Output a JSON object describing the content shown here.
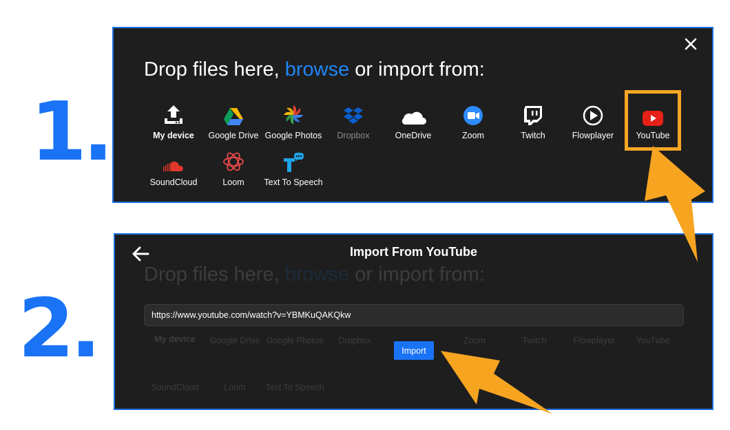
{
  "steps": [
    "1.",
    "2."
  ],
  "panel1": {
    "heading_pre": "Drop files here,",
    "heading_link": "browse",
    "heading_post": "or import from:",
    "sources": [
      {
        "label": "My device",
        "icon": "upload-icon"
      },
      {
        "label": "Google Drive",
        "icon": "google-drive-icon"
      },
      {
        "label": "Google Photos",
        "icon": "google-photos-icon"
      },
      {
        "label": "Dropbox",
        "icon": "dropbox-icon"
      },
      {
        "label": "OneDrive",
        "icon": "onedrive-icon"
      },
      {
        "label": "Zoom",
        "icon": "zoom-icon"
      },
      {
        "label": "Twitch",
        "icon": "twitch-icon"
      },
      {
        "label": "Flowplayer",
        "icon": "flowplayer-icon"
      },
      {
        "label": "YouTube",
        "icon": "youtube-icon"
      },
      {
        "label": "SoundCloud",
        "icon": "soundcloud-icon"
      },
      {
        "label": "Loom",
        "icon": "loom-icon"
      },
      {
        "label": "Text To Speech",
        "icon": "text-to-speech-icon"
      }
    ]
  },
  "panel2": {
    "title": "Import From YouTube",
    "url_value": "https://www.youtube.com/watch?v=YBMKuQAKQkw",
    "import_label": "Import"
  },
  "colors": {
    "accent": "#1a73f5",
    "highlight": "#f5a623",
    "panel_bg": "#1e1e1e",
    "border": "#1e6fe0"
  }
}
